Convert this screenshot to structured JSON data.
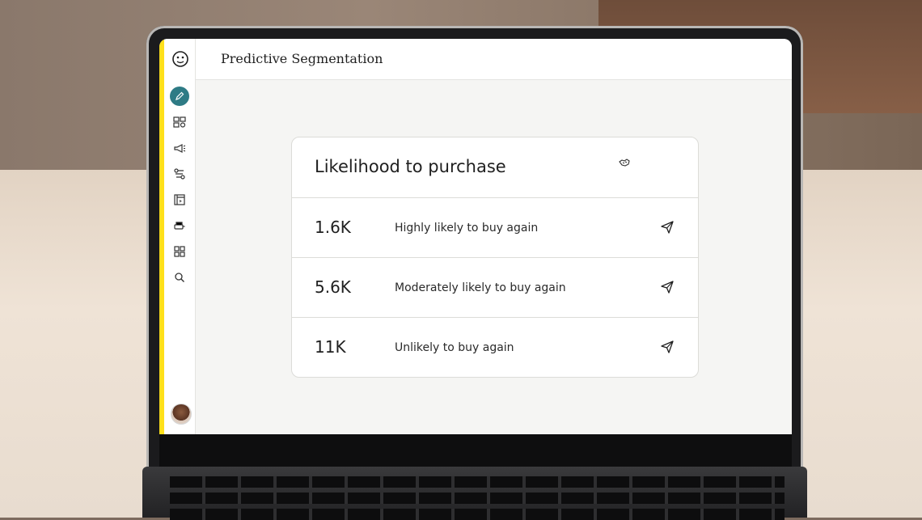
{
  "app": {
    "page_title": "Predictive Segmentation"
  },
  "sidebar": {
    "items": [
      {
        "icon": "pencil-icon",
        "active": true
      },
      {
        "icon": "audience-icon"
      },
      {
        "icon": "megaphone-icon"
      },
      {
        "icon": "automation-icon"
      },
      {
        "icon": "website-icon"
      },
      {
        "icon": "content-icon"
      },
      {
        "icon": "integrations-grid-icon"
      },
      {
        "icon": "search-icon"
      }
    ],
    "accent": "#2e7b85",
    "strip_color": "#ffe01b"
  },
  "card": {
    "title": "Likelihood to purchase",
    "rows": [
      {
        "count": "1.6K",
        "label": "Highly likely to buy again"
      },
      {
        "count": "5.6K",
        "label": "Moderately likely to buy again"
      },
      {
        "count": "11K",
        "label": "Unlikely to buy again"
      }
    ]
  }
}
